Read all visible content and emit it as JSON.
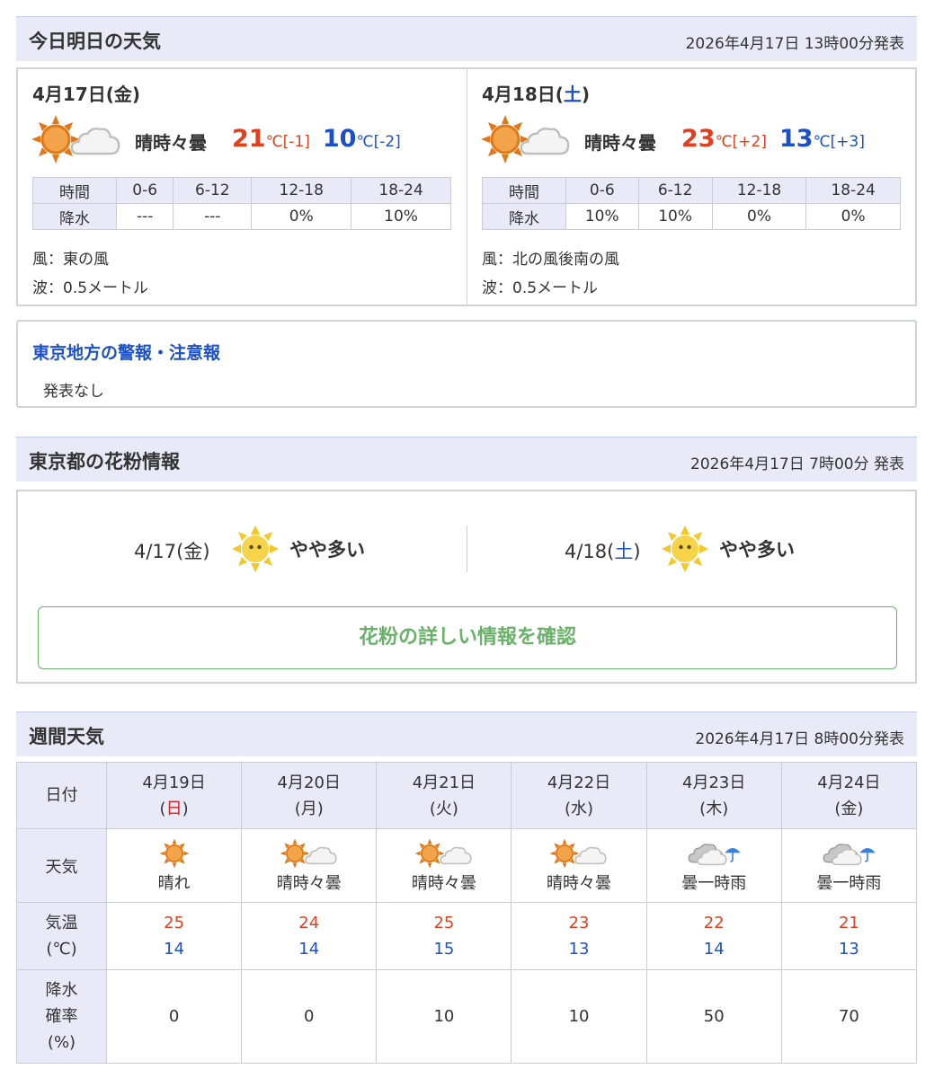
{
  "today_section": {
    "title": "今日明日の天気",
    "issued": "2026年4月17日 13時00分発表",
    "days": [
      {
        "date_prefix": "4月17日(",
        "weekday": "金",
        "date_suffix": ")",
        "weather_icon": "sunny-then-cloudy-icon",
        "weather": "晴時々曇",
        "high": "21",
        "high_unit": "℃",
        "high_diff": "[-1]",
        "low": "10",
        "low_unit": "℃",
        "low_diff": "[-2]",
        "rain_header": [
          "時間",
          "0-6",
          "6-12",
          "12-18",
          "18-24"
        ],
        "rain_values": [
          "降水",
          "---",
          "---",
          "0%",
          "10%"
        ],
        "wind": "風：東の風",
        "wave": "波：0.5メートル"
      },
      {
        "date_prefix": "4月18日(",
        "weekday": "土",
        "date_suffix": ")",
        "weather_icon": "sunny-then-cloudy-icon",
        "weather": "晴時々曇",
        "high": "23",
        "high_unit": "℃",
        "high_diff": "[+2]",
        "low": "13",
        "low_unit": "℃",
        "low_diff": "[+3]",
        "rain_header": [
          "時間",
          "0-6",
          "6-12",
          "12-18",
          "18-24"
        ],
        "rain_values": [
          "降水",
          "10%",
          "10%",
          "0%",
          "0%"
        ],
        "wind": "風：北の風後南の風",
        "wave": "波：0.5メートル"
      }
    ]
  },
  "warnings": {
    "title": "東京地方の警報・注意報",
    "text": "発表なし"
  },
  "pollen_section": {
    "title": "東京都の花粉情報",
    "issued": "2026年4月17日 7時00分 発表",
    "days": [
      {
        "date_prefix": "4/17(",
        "weekday": "金",
        "date_suffix": ")",
        "icon": "pollen-sun-face-icon",
        "level": "やや多い"
      },
      {
        "date_prefix": "4/18(",
        "weekday": "土",
        "date_suffix": ")",
        "icon": "pollen-sun-face-icon",
        "level": "やや多い"
      }
    ],
    "details_button": "花粉の詳しい情報を確認"
  },
  "weekly_section": {
    "title": "週間天気",
    "issued": "2026年4月17日 8時00分発表",
    "row_labels": {
      "date": "日付",
      "weather": "天気",
      "temp_line1": "気温",
      "temp_line2": "(℃)",
      "rain_line1": "降水",
      "rain_line2": "確率",
      "rain_line3": "(%)"
    },
    "days": [
      {
        "date": "4月19日",
        "wd_open": "(",
        "weekday": "日",
        "wd_close": ")",
        "icon": "sunny-icon",
        "weather": "晴れ",
        "high": "25",
        "low": "14",
        "rain": "0"
      },
      {
        "date": "4月20日",
        "wd_open": "(",
        "weekday": "月",
        "wd_close": ")",
        "icon": "sunny-then-cloudy-icon",
        "weather": "晴時々曇",
        "high": "24",
        "low": "14",
        "rain": "0"
      },
      {
        "date": "4月21日",
        "wd_open": "(",
        "weekday": "火",
        "wd_close": ")",
        "icon": "sunny-then-cloudy-icon",
        "weather": "晴時々曇",
        "high": "25",
        "low": "15",
        "rain": "10"
      },
      {
        "date": "4月22日",
        "wd_open": "(",
        "weekday": "水",
        "wd_close": ")",
        "icon": "sunny-then-cloudy-icon",
        "weather": "晴時々曇",
        "high": "23",
        "low": "13",
        "rain": "10"
      },
      {
        "date": "4月23日",
        "wd_open": "(",
        "weekday": "木",
        "wd_close": ")",
        "icon": "cloudy-rain-icon",
        "weather": "曇一時雨",
        "high": "22",
        "low": "14",
        "rain": "50"
      },
      {
        "date": "4月24日",
        "wd_open": "(",
        "weekday": "金",
        "wd_close": ")",
        "icon": "cloudy-rain-icon",
        "weather": "曇一時雨",
        "high": "21",
        "low": "13",
        "rain": "70"
      }
    ]
  },
  "colors": {
    "header_bg": "#e8ebf7",
    "high_temp": "#e0401d",
    "low_temp": "#1c50c8",
    "saturday": "#1c50c8",
    "sunday": "#d82020",
    "pollen_button": "#6ab26a",
    "link_blue": "#1c50c8"
  }
}
